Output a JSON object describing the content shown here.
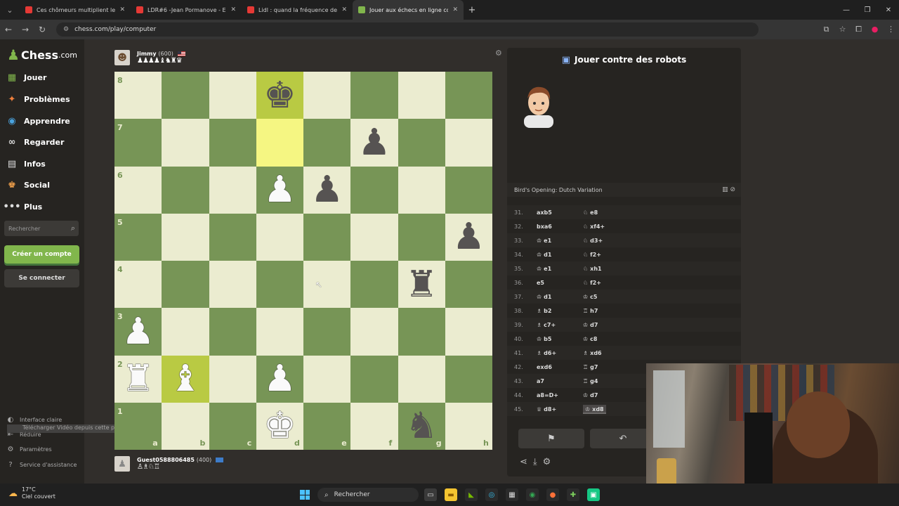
{
  "browser": {
    "tabs": [
      {
        "title": "Ces chômeurs multiplient les c...",
        "active": false,
        "favicon": "youtube"
      },
      {
        "title": "LDR#6 -Jean Pormanove - Enqu",
        "active": false,
        "favicon": "youtube"
      },
      {
        "title": "Lidl : quand la fréquence de tra",
        "active": false,
        "favicon": "youtube"
      },
      {
        "title": "Jouer aux échecs en ligne contr",
        "active": true,
        "favicon": "chess"
      }
    ],
    "url": "chess.com/play/computer"
  },
  "sidebar": {
    "logo_main": "Chess",
    "logo_suffix": ".com",
    "items": [
      {
        "label": "Jouer",
        "icon": "board-icon"
      },
      {
        "label": "Problèmes",
        "icon": "puzzle-icon"
      },
      {
        "label": "Apprendre",
        "icon": "learn-icon"
      },
      {
        "label": "Regarder",
        "icon": "binoculars-icon"
      },
      {
        "label": "Infos",
        "icon": "news-icon"
      },
      {
        "label": "Social",
        "icon": "social-icon"
      },
      {
        "label": "Plus",
        "icon": "more-icon"
      }
    ],
    "search_placeholder": "Rechercher",
    "create_account": "Créer un compte",
    "login": "Se connecter",
    "footer": [
      "Interface claire",
      "Réduire",
      "Paramètres",
      "Service d'assistance"
    ],
    "download_tip": "Télécharger Vidéo depuis cette page"
  },
  "top_player": {
    "name": "Jimmy",
    "rating": "(600)",
    "captured": "♟♟♟♟♝♞♜♛"
  },
  "bottom_player": {
    "name": "Guest0588806485",
    "rating": "(400)",
    "captured": "♙♗♘♖"
  },
  "board": {
    "ranks": [
      "8",
      "7",
      "6",
      "5",
      "4",
      "3",
      "2",
      "1"
    ],
    "files": [
      "a",
      "b",
      "c",
      "d",
      "e",
      "f",
      "g",
      "h"
    ],
    "highlight": [
      "d8",
      "d7",
      "b2"
    ],
    "pieces": [
      {
        "sq": "d8",
        "color": "b",
        "glyph": "♚"
      },
      {
        "sq": "f7",
        "color": "b",
        "glyph": "♟"
      },
      {
        "sq": "d6",
        "color": "w",
        "glyph": "♟"
      },
      {
        "sq": "e6",
        "color": "b",
        "glyph": "♟"
      },
      {
        "sq": "h5",
        "color": "b",
        "glyph": "♟"
      },
      {
        "sq": "g4",
        "color": "b",
        "glyph": "♜"
      },
      {
        "sq": "a3",
        "color": "w",
        "glyph": "♟"
      },
      {
        "sq": "a2",
        "color": "w",
        "glyph": "♜"
      },
      {
        "sq": "b2",
        "color": "w",
        "glyph": "♝"
      },
      {
        "sq": "d2",
        "color": "w",
        "glyph": "♟"
      },
      {
        "sq": "d1",
        "color": "w",
        "glyph": "♚"
      },
      {
        "sq": "g1",
        "color": "b",
        "glyph": "♞"
      }
    ]
  },
  "panel": {
    "title": "Jouer contre des robots",
    "opening": "Bird's Opening: Dutch Variation",
    "moves": [
      {
        "n": "31.",
        "w": "axb5",
        "b": "e8",
        "bp": "♘"
      },
      {
        "n": "32.",
        "w": "bxa6",
        "b": "xf4+",
        "bp": "♘"
      },
      {
        "n": "33.",
        "w": "e1",
        "wp": "♔",
        "b": "d3+",
        "bp": "♘"
      },
      {
        "n": "34.",
        "w": "d1",
        "wp": "♔",
        "b": "f2+",
        "bp": "♘"
      },
      {
        "n": "35.",
        "w": "e1",
        "wp": "♔",
        "b": "xh1",
        "bp": "♘"
      },
      {
        "n": "36.",
        "w": "e5",
        "b": "f2+",
        "bp": "♘"
      },
      {
        "n": "37.",
        "w": "d1",
        "wp": "♔",
        "b": "c5",
        "bp": "♔"
      },
      {
        "n": "38.",
        "w": "b2",
        "wp": "♗",
        "b": "h7",
        "bp": "♖"
      },
      {
        "n": "39.",
        "w": "c7+",
        "wp": "♗",
        "b": "d7",
        "bp": "♔"
      },
      {
        "n": "40.",
        "w": "b5",
        "wp": "♔",
        "b": "c8",
        "bp": "♔"
      },
      {
        "n": "41.",
        "w": "d6+",
        "wp": "♗",
        "b": "xd6",
        "bp": "♗"
      },
      {
        "n": "42.",
        "w": "exd6",
        "b": "g7",
        "bp": "♖"
      },
      {
        "n": "43.",
        "w": "a7",
        "b": "g4",
        "bp": "♖"
      },
      {
        "n": "44.",
        "w": "a8=D+",
        "b": "d7",
        "bp": "♔"
      },
      {
        "n": "45.",
        "w": "d8+",
        "wp": "♕",
        "b": "xd8",
        "bp": "♔"
      }
    ]
  },
  "taskbar": {
    "temperature": "17°C",
    "weather": "Ciel couvert",
    "search": "Rechercher"
  },
  "colors": {
    "board_light": "#ebecd0",
    "board_dark": "#779556",
    "accent_green": "#81b64c",
    "highlight_light": "#f5f682",
    "highlight_dark": "#b9ca43"
  }
}
